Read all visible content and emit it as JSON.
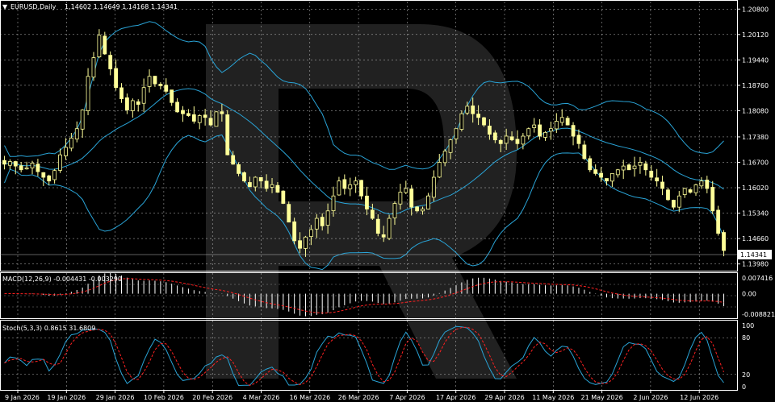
{
  "header": {
    "symbol": "EURUSD,Daily",
    "ohlc": "1.14602 1.14649 1.14168 1.14341"
  },
  "price_axis": {
    "ticks": [
      "1.20800",
      "1.20120",
      "1.19440",
      "1.18760",
      "1.18080",
      "1.17380",
      "1.16700",
      "1.16020",
      "1.15340",
      "1.14660",
      "1.13980"
    ],
    "current": "1.14341"
  },
  "macd": {
    "label": "MACD(12,26,9) -0.004431 -0.003290",
    "ticks": [
      "0.007416",
      "0.00",
      "-0.008821"
    ]
  },
  "stoch": {
    "label": "Stoch(5,3,3) 0.8615 31.6809",
    "ticks": [
      "100",
      "80",
      "20",
      "0"
    ]
  },
  "time_axis": [
    "9 Jan 2026",
    "19 Jan 2026",
    "29 Jan 2026",
    "10 Feb 2026",
    "20 Feb 2026",
    "4 Mar 2026",
    "16 Mar 2026",
    "26 Mar 2026",
    "7 Apr 2026",
    "17 Apr 2026",
    "29 Apr 2026",
    "11 May 2026",
    "21 May 2026",
    "2 Jun 2026",
    "12 Jun 2026"
  ],
  "watermark": "R",
  "colors": {
    "background": "#000000",
    "grid": "#ffffff",
    "candle": "#ffff99",
    "bands": "#29a3d6",
    "macd_signal": "#ff2020",
    "stoch_main": "#29a3d6",
    "stoch_signal": "#ff2020"
  },
  "chart_data": {
    "type": "candlestick",
    "ohlc_closes": [
      1.1665,
      1.1672,
      1.166,
      1.165,
      1.1655,
      1.1668,
      1.1645,
      1.163,
      1.162,
      1.1648,
      1.169,
      1.171,
      1.1735,
      1.176,
      1.181,
      1.19,
      1.195,
      1.201,
      1.196,
      1.192,
      1.187,
      1.184,
      1.181,
      1.1835,
      1.1825,
      1.187,
      1.19,
      1.188,
      1.1875,
      1.186,
      1.183,
      1.1805,
      1.18,
      1.1795,
      1.178,
      1.1795,
      1.179,
      1.177,
      1.1805,
      1.18,
      1.169,
      1.1665,
      1.164,
      1.162,
      1.1605,
      1.163,
      1.162,
      1.16,
      1.161,
      1.159,
      1.156,
      1.151,
      1.146,
      1.144,
      1.147,
      1.149,
      1.152,
      1.15,
      1.154,
      1.158,
      1.162,
      1.16,
      1.161,
      1.162,
      1.158,
      1.1545,
      1.152,
      1.148,
      1.147,
      1.152,
      1.156,
      1.159,
      1.16,
      1.155,
      1.154,
      1.1545,
      1.158,
      1.163,
      1.167,
      1.17,
      1.173,
      1.176,
      1.18,
      1.182,
      1.18,
      1.179,
      1.177,
      1.1745,
      1.173,
      1.172,
      1.174,
      1.173,
      1.172,
      1.174,
      1.176,
      1.177,
      1.174,
      1.175,
      1.176,
      1.178,
      1.179,
      1.177,
      1.174,
      1.172,
      1.168,
      1.165,
      1.164,
      1.163,
      1.162,
      1.164,
      1.165,
      1.166,
      1.165,
      1.166,
      1.167,
      1.165,
      1.163,
      1.162,
      1.16,
      1.157,
      1.155,
      1.158,
      1.16,
      1.159,
      1.161,
      1.162,
      1.16,
      1.154,
      1.148,
      1.1434
    ],
    "price_range": [
      1.138,
      1.21
    ],
    "macd_range": [
      -0.008821,
      0.007416
    ],
    "stoch_range": [
      0,
      100
    ],
    "stoch_levels": [
      20,
      80
    ]
  }
}
